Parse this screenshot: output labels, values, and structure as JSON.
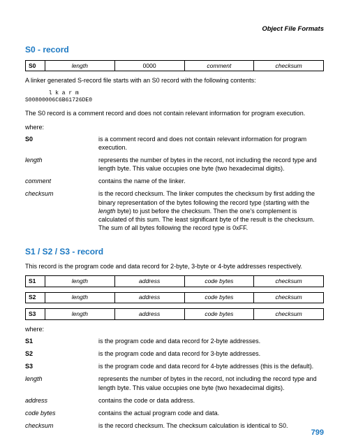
{
  "header": {
    "title": "Object File Formats"
  },
  "s0": {
    "heading": "S0 - record",
    "table": {
      "c0": "S0",
      "c1": "length",
      "c2": "0000",
      "c3": "comment",
      "c4": "checksum"
    },
    "intro": "A linker generated S-record file starts with an S0 record with the following contents:",
    "mono1": "       l k a r m",
    "mono2": "S00800006C6B61726DE0",
    "note": "The S0 record is a comment record and does not contain relevant information for program execution.",
    "where": "where:",
    "defs": [
      {
        "term": "S0",
        "style": "bold",
        "desc": "is a comment record and does not contain relevant information for program execution."
      },
      {
        "term": "length",
        "style": "italic",
        "desc": "represents the number of bytes in the record, not including the record type and length byte. This value occupies one byte (two hexadecimal digits)."
      },
      {
        "term": "comment",
        "style": "italic",
        "desc": "contains the name of the linker."
      },
      {
        "term": "checksum",
        "style": "italic",
        "desc_pre": "is the record checksum. The linker computes the checksum by first adding the binary representation of the bytes following the record type (starting with the ",
        "desc_em": "length",
        "desc_post": " byte) to just before the checksum. Then the one's complement is calculated of this sum. The least significant byte of the result is the checksum. The sum of all bytes following the record type is 0xFF."
      }
    ]
  },
  "s123": {
    "heading": "S1 / S2 / S3 - record",
    "intro": "This record is the program code and data record for 2-byte, 3-byte or 4-byte addresses respectively.",
    "tables": [
      {
        "c0": "S1",
        "c1": "length",
        "c2": "address",
        "c3": "code bytes",
        "c4": "checksum"
      },
      {
        "c0": "S2",
        "c1": "length",
        "c2": "address",
        "c3": "code bytes",
        "c4": "checksum"
      },
      {
        "c0": "S3",
        "c1": "length",
        "c2": "address",
        "c3": "code bytes",
        "c4": "checksum"
      }
    ],
    "where": "where:",
    "defs": [
      {
        "term": "S1",
        "style": "bold",
        "desc": "is the program code and data record for 2-byte addresses."
      },
      {
        "term": "S2",
        "style": "bold",
        "desc": "is the program code and data record for 3-byte addresses."
      },
      {
        "term": "S3",
        "style": "bold",
        "desc": "is the program code and data record for 4-byte addresses (this is the default)."
      },
      {
        "term": "length",
        "style": "italic",
        "desc": "represents the number of bytes in the record, not including the record type and length byte. This value occupies one byte (two hexadecimal digits)."
      },
      {
        "term": "address",
        "style": "italic",
        "desc": "contains the code or data address."
      },
      {
        "term": "code bytes",
        "style": "italic",
        "desc": "contains the actual program code and data."
      },
      {
        "term": "checksum",
        "style": "italic",
        "desc": "is the record checksum. The checksum calculation is identical to S0."
      }
    ]
  },
  "page_number": "799"
}
